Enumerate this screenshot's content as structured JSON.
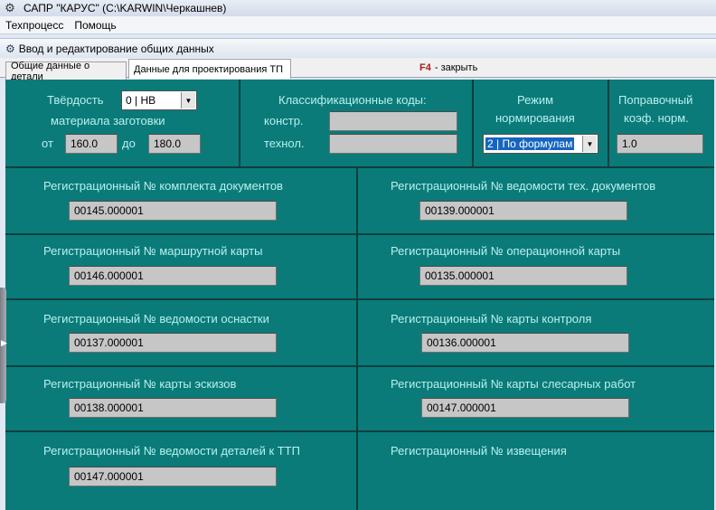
{
  "window": {
    "title": "САПР \"КАРУС\" (C:\\KARWIN\\Черкашнев)"
  },
  "menu": {
    "items": [
      {
        "label": "Техпроцесс"
      },
      {
        "label": "Помощь"
      }
    ]
  },
  "subwindow": {
    "title": "Ввод и редактирование общих данных"
  },
  "tabs": [
    {
      "label": "Общие данные о детали"
    },
    {
      "label": "Данные для проектирования ТП"
    }
  ],
  "hint": {
    "key": "F4",
    "text": "- закрыть"
  },
  "hardness": {
    "label": "Твёрдость",
    "label2": "материала заготовки",
    "select_value": "0 | HB",
    "from_label": "от",
    "from_value": "160.0",
    "to_label": "до",
    "to_value": "180.0"
  },
  "codes": {
    "title": "Классификационные коды:",
    "constr_label": "констр.",
    "constr_value": "",
    "techn_label": "технол.",
    "techn_value": ""
  },
  "mode": {
    "title1": "Режим",
    "title2": "нормирования",
    "select_value": "2 | По формулам"
  },
  "coef": {
    "title1": "Поправочный",
    "title2": "коэф. норм.",
    "value": "1.0"
  },
  "registrations": {
    "complect": {
      "label": "Регистрационный № комплекта документов",
      "value": "00145.000001"
    },
    "vedomost_tech": {
      "label": "Регистрационный №  ведомости тех. документов",
      "value": "00139.000001"
    },
    "route": {
      "label": "Регистрационный № маршрутной карты",
      "value": "00146.000001"
    },
    "operation": {
      "label": "Регистрационный № операционной карты",
      "value": "00135.000001"
    },
    "osnastka": {
      "label": "Регистрационный № ведомости оснастки",
      "value": "00137.000001"
    },
    "control": {
      "label": "Регистрационный № карты контроля",
      "value": "00136.000001"
    },
    "sketch": {
      "label": "Регистрационный № карты эскизов",
      "value": "00138.000001"
    },
    "slesar": {
      "label": "Регистрационный № карты слесарных работ",
      "value": "00147.000001"
    },
    "ttp": {
      "label": "Регистрационный № ведомости деталей к ТТП",
      "value": "00147.000001"
    },
    "notice": {
      "label": "Регистрационный № извещения"
    }
  }
}
